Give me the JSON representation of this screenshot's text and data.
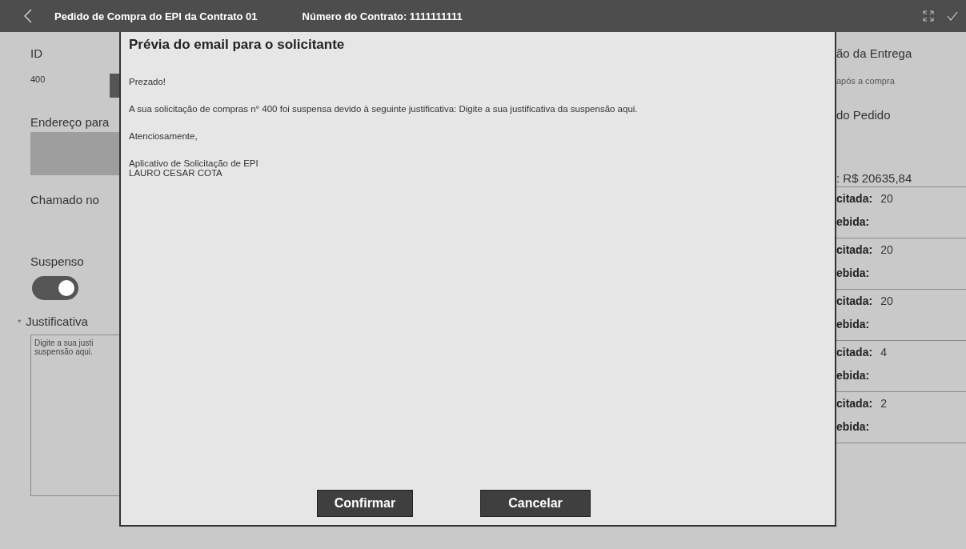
{
  "header": {
    "title": "Pedido de Compra do EPI da Contrato 01",
    "contract": "Número do Contrato: 1111111111"
  },
  "left": {
    "id_label": "ID",
    "id_value": "400",
    "address_label": "Endereço para",
    "ticket_label": "Chamado no",
    "suspended_label": "Suspenso",
    "suspended_on": true,
    "required_mark": "*",
    "justification_label": "Justificativa",
    "justification_value": "Digite a sua justi\nsuspensão aqui."
  },
  "dialog": {
    "title": "Prévia do email para o solicitante",
    "paragraphs": [
      [
        "Prezado!"
      ],
      [
        "A sua solicitação de compras n° 400 foi suspensa devido à seguinte justificativa: Digite a sua justificativa da suspensão aqui."
      ],
      [
        "Atenciosamente,"
      ],
      [
        "Aplicativo de Solicitação de EPI",
        "LAURO CESAR COTA"
      ]
    ],
    "buttons": [
      "Confirmar",
      "Cancelar"
    ]
  },
  "right": {
    "delivery_label": "ão da Entrega",
    "delivery_value": "após a compra",
    "order_label": "do Pedido",
    "total": ": R$ 20635,84",
    "items": [
      {
        "requested_label": "citada:",
        "requested": "20",
        "received_label": "ebida:"
      },
      {
        "requested_label": "citada:",
        "requested": "20",
        "received_label": "ebida:"
      },
      {
        "requested_label": "citada:",
        "requested": "20",
        "received_label": "ebida:"
      },
      {
        "requested_label": "citada:",
        "requested": "4",
        "received_label": "ebida:"
      },
      {
        "requested_label": "citada:",
        "requested": "2",
        "received_label": "ebida:"
      }
    ]
  }
}
